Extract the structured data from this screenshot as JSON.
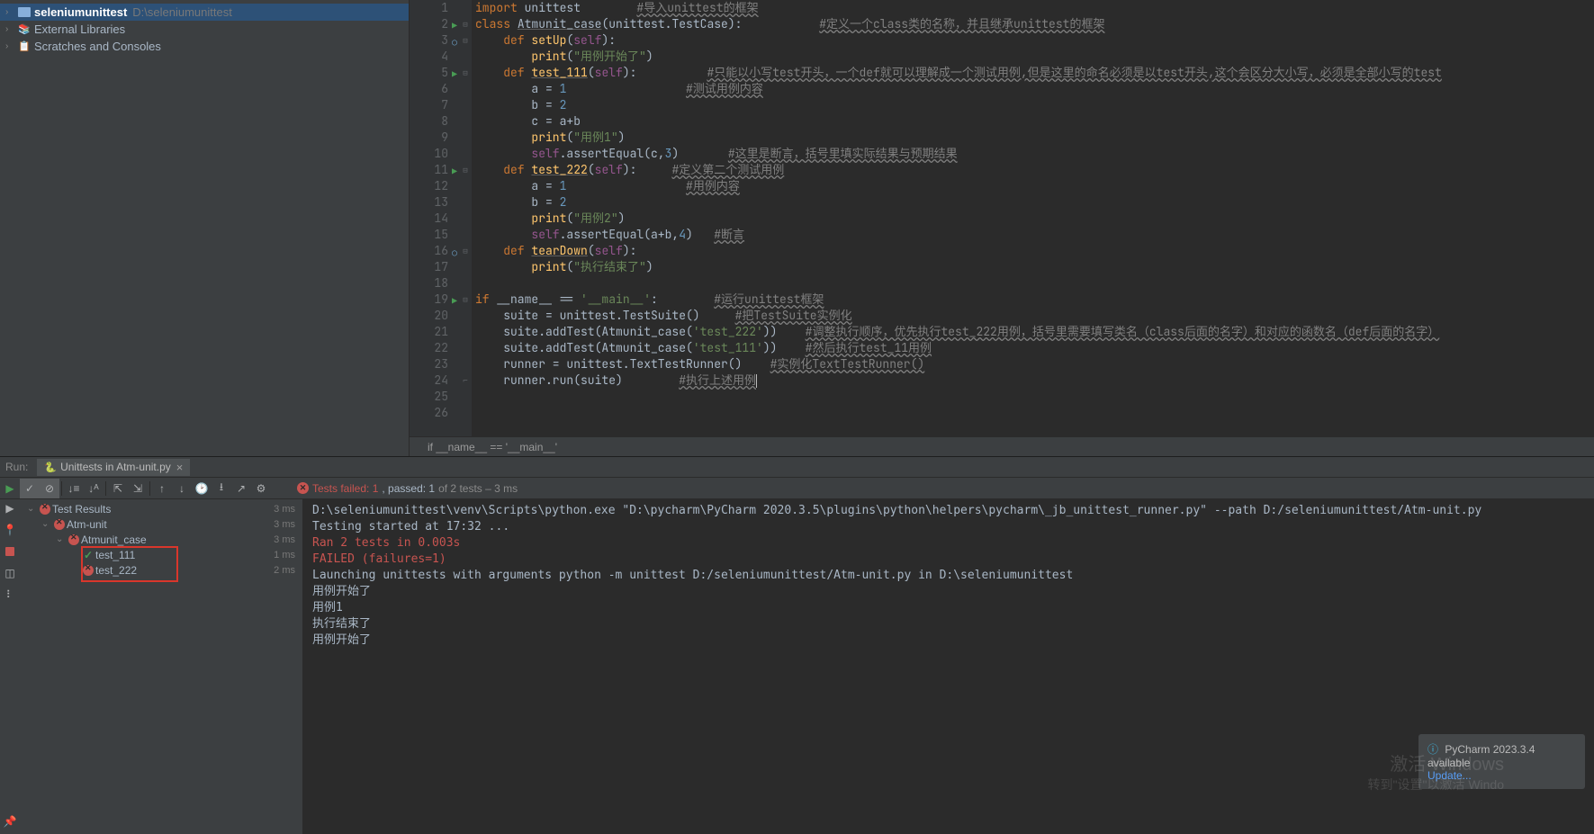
{
  "project": {
    "root_name": "seleniumunittest",
    "root_path": "D:\\seleniumunittest",
    "ext_libs": "External Libraries",
    "scratches": "Scratches and Consoles"
  },
  "code_lines": [
    {
      "n": 1,
      "html": "<span class='kw'>import</span> unittest        <span class='cmt-u'>#导入unittest的框架</span>"
    },
    {
      "n": 2,
      "html": "<span class='kw'>class</span> <span class='underl'>Atmunit_case</span>(unittest.TestCase):           <span class='cmt-u'>#定义一个class类的名称，并且继承unittest的框架</span>"
    },
    {
      "n": 3,
      "html": "    <span class='kw'>def</span> <span class='fn'>setUp</span>(<span class='self'>self</span>):"
    },
    {
      "n": 4,
      "html": "        <span class='fn'>print</span>(<span class='str'>\"用例开始了\"</span>)"
    },
    {
      "n": 5,
      "html": "    <span class='kw'>def</span> <span class='fn underl'>test_111</span>(<span class='self'>self</span>):          <span class='cmt-u'>#只能以小写test开头，一个def就可以理解成一个测试用例,但是这里的命名必须是以test开头,这个会区分大小写，必须是全部小写的test</span>"
    },
    {
      "n": 6,
      "html": "        a = <span class='num'>1</span>                 <span class='cmt-u'>#测试用例内容</span>"
    },
    {
      "n": 7,
      "html": "        b = <span class='num'>2</span>"
    },
    {
      "n": 8,
      "html": "        c = a+b"
    },
    {
      "n": 9,
      "html": "        <span class='fn'>print</span>(<span class='str'>\"用例1\"</span>)"
    },
    {
      "n": 10,
      "html": "        <span class='self'>self</span>.assertEqual(c,<span class='num'>3</span>)       <span class='cmt-u'>#这里是断言，括号里填实际结果与预期结果</span>"
    },
    {
      "n": 11,
      "html": "    <span class='kw'>def</span> <span class='fn underl'>test_222</span>(<span class='self'>self</span>):     <span class='cmt-u'>#定义第二个测试用例</span>"
    },
    {
      "n": 12,
      "html": "        a = <span class='num'>1</span>                 <span class='cmt-u'>#用例内容</span>"
    },
    {
      "n": 13,
      "html": "        b = <span class='num'>2</span>"
    },
    {
      "n": 14,
      "html": "        <span class='fn'>print</span>(<span class='str'>\"用例2\"</span>)"
    },
    {
      "n": 15,
      "html": "        <span class='self'>self</span>.assertEqual(a+b,<span class='num'>4</span>)   <span class='cmt-u'>#断言</span>"
    },
    {
      "n": 16,
      "html": "    <span class='kw'>def</span> <span class='fn underl'>tearDown</span>(<span class='self'>self</span>):"
    },
    {
      "n": 17,
      "html": "        <span class='fn'>print</span>(<span class='str'>\"执行结束了\"</span>)"
    },
    {
      "n": 18,
      "html": ""
    },
    {
      "n": 19,
      "html": "<span class='kw'>if</span> __name__ == <span class='str'>'__main__'</span>:        <span class='cmt-u'>#运行unittest框架</span>"
    },
    {
      "n": 20,
      "html": "    suite = unittest.TestSuite()     <span class='cmt-u'>#把TestSuite实例化</span>"
    },
    {
      "n": 21,
      "html": "    suite.addTest(Atmunit_case(<span class='str'>'test_222'</span>))    <span class='cmt-u'>#调整执行顺序，优先执行test_222用例，括号里需要填写类名（class后面的名字）和对应的函数名（def后面的名字）</span>"
    },
    {
      "n": 22,
      "html": "    suite.addTest(Atmunit_case(<span class='str'>'test_111'</span>))    <span class='cmt-u'>#然后执行test_11用例</span>"
    },
    {
      "n": 23,
      "html": "    runner = unittest.TextTestRunner()    <span class='cmt-u'>#实例化TextTestRunner()</span>"
    },
    {
      "n": 24,
      "html": "    runner.run(suite)        <span class='cmt-u'>#执行上述用例</span><span class='caret'></span>"
    },
    {
      "n": 25,
      "html": ""
    },
    {
      "n": 26,
      "html": ""
    }
  ],
  "gutter_marks": {
    "2": "run",
    "5": "run",
    "11": "run",
    "19": "run",
    "3": "diff",
    "16": "diff"
  },
  "breadcrumb": "if __name__ == '__main__'",
  "run": {
    "label": "Run:",
    "tab": "Unittests in Atm-unit.py",
    "status_fail": "Tests failed: 1",
    "status_pass": ", passed: 1",
    "status_tail": " of 2 tests – 3 ms"
  },
  "test_tree": [
    {
      "indent": 0,
      "arrow": "⌄",
      "status": "fail",
      "label": "Test Results",
      "time": "3 ms"
    },
    {
      "indent": 1,
      "arrow": "⌄",
      "status": "fail",
      "label": "Atm-unit",
      "time": "3 ms"
    },
    {
      "indent": 2,
      "arrow": "⌄",
      "status": "fail",
      "label": "Atmunit_case",
      "time": "3 ms"
    },
    {
      "indent": 3,
      "arrow": "",
      "status": "pass",
      "label": "test_111",
      "time": "1 ms"
    },
    {
      "indent": 3,
      "arrow": "",
      "status": "fail",
      "label": "test_222",
      "time": "2 ms"
    }
  ],
  "console": [
    {
      "cls": "plain",
      "text": "D:\\seleniumunittest\\venv\\Scripts\\python.exe \"D:\\pycharm\\PyCharm 2020.3.5\\plugins\\python\\helpers\\pycharm\\_jb_unittest_runner.py\" --path D:/seleniumunittest/Atm-unit.py"
    },
    {
      "cls": "plain",
      "text": "Testing started at 17:32 ..."
    },
    {
      "cls": "plain",
      "text": ""
    },
    {
      "cls": "plain",
      "text": ""
    },
    {
      "cls": "red",
      "text": "Ran 2 tests in 0.003s"
    },
    {
      "cls": "plain",
      "text": ""
    },
    {
      "cls": "red",
      "text": "FAILED (failures=1)"
    },
    {
      "cls": "plain",
      "text": "Launching unittests with arguments python -m unittest D:/seleniumunittest/Atm-unit.py in D:\\seleniumunittest"
    },
    {
      "cls": "plain",
      "text": ""
    },
    {
      "cls": "plain",
      "text": "用例开始了"
    },
    {
      "cls": "plain",
      "text": "用例1"
    },
    {
      "cls": "plain",
      "text": "执行结束了"
    },
    {
      "cls": "plain",
      "text": "用例开始了"
    }
  ],
  "notif": {
    "title": "PyCharm 2023.3.4 available",
    "action": "Update..."
  },
  "watermark": {
    "line1": "激活 Windows",
    "line2": "转到\"设置\"以激活 Windo"
  }
}
